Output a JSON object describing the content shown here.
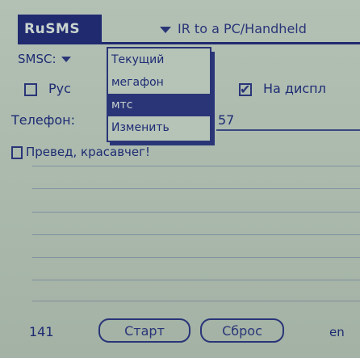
{
  "app": {
    "title": "RuSMS"
  },
  "header": {
    "destination": "IR to a PC/Handheld"
  },
  "smsc": {
    "label": "SMSC:",
    "options": [
      "Текущий",
      "мегафон",
      "мтс",
      "Изменить"
    ],
    "selected_index": 2
  },
  "options": {
    "russian_label": "Рус",
    "russian_checked": false,
    "display_label": "На диспл",
    "display_checked": true
  },
  "phone": {
    "label": "Телефон:",
    "value": "57"
  },
  "message": {
    "text": "Превед, красавчег!"
  },
  "footer": {
    "counter": "141",
    "start_label": "Старт",
    "reset_label": "Сброс",
    "lang": "en"
  },
  "colors": {
    "ink": "#1f2a6f",
    "screen": "#a9b7ab"
  }
}
